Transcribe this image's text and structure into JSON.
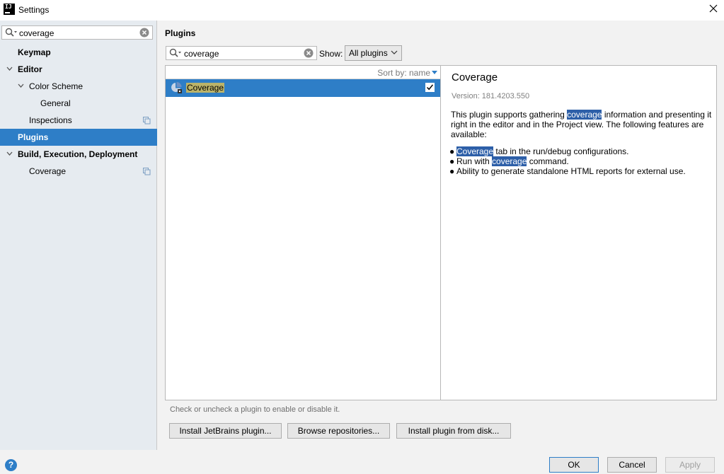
{
  "window": {
    "title": "Settings",
    "app_icon_text": "IJ"
  },
  "sidebar": {
    "search_value": "coverage",
    "items": [
      {
        "label": "Keymap"
      },
      {
        "label": "Editor"
      },
      {
        "label": "Color Scheme"
      },
      {
        "label": "General"
      },
      {
        "label": "Inspections"
      },
      {
        "label": "Plugins"
      },
      {
        "label": "Build, Execution, Deployment"
      },
      {
        "label": "Coverage"
      }
    ]
  },
  "main": {
    "title": "Plugins",
    "search_value": "coverage",
    "show_label": "Show:",
    "show_selected": "All plugins",
    "sort_label": "Sort by: name",
    "plugins": [
      {
        "name": "Coverage",
        "checked": true
      }
    ],
    "detail": {
      "title": "Coverage",
      "version": "Version: 181.4203.550",
      "desc_p1": "This plugin supports gathering ",
      "desc_hl": "coverage",
      "desc_p2": " information and presenting it right in the editor and in the Project view. The following features are available:",
      "features": [
        {
          "pre": "",
          "hl": "Coverage",
          "post": " tab in the run/debug configurations."
        },
        {
          "pre": "Run with ",
          "hl": "coverage",
          "post": " command."
        },
        {
          "pre": "Ability to generate standalone HTML reports for external use.",
          "hl": "",
          "post": ""
        }
      ]
    },
    "hint": "Check or uncheck a plugin to enable or disable it.",
    "buttons": {
      "install_jetbrains": "Install JetBrains plugin...",
      "browse": "Browse repositories...",
      "install_disk": "Install plugin from disk..."
    }
  },
  "footer": {
    "help": "?",
    "ok": "OK",
    "cancel": "Cancel",
    "apply": "Apply"
  },
  "colors": {
    "selection": "#2e7ec7",
    "highlight": "#2d5fa8",
    "match": "#bbb369"
  }
}
